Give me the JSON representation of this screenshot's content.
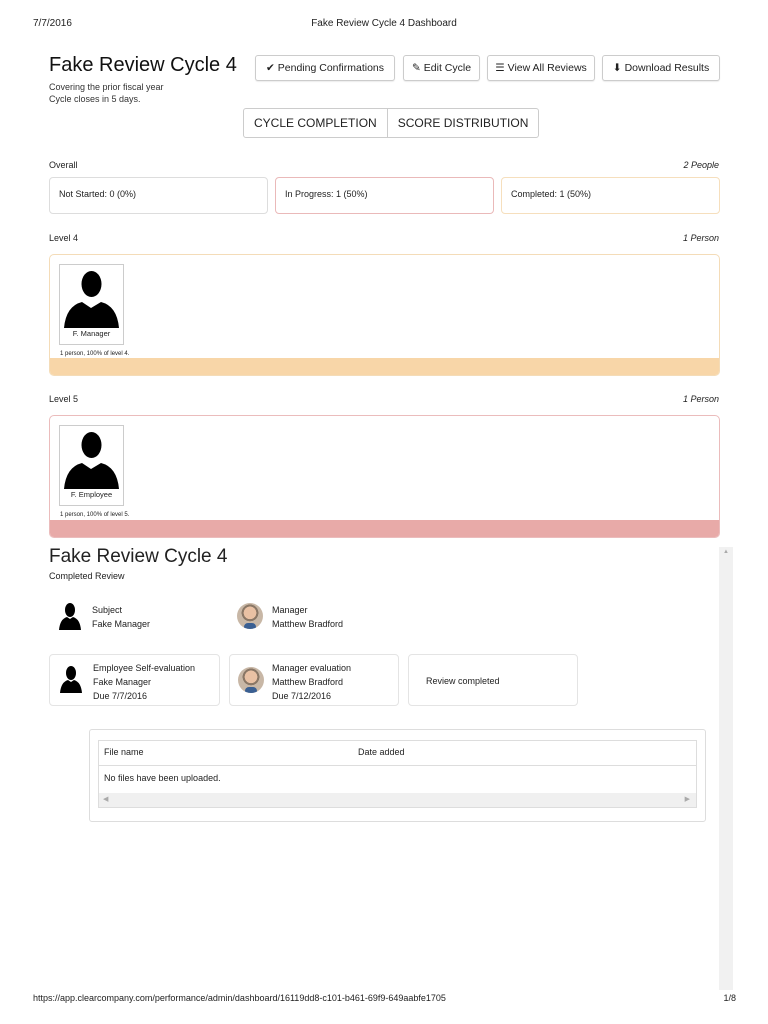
{
  "print_header": {
    "date": "7/7/2016",
    "title": "Fake Review Cycle 4 Dashboard"
  },
  "print_footer": {
    "url": "https://app.clearcompany.com/performance/admin/dashboard/16119dd8-c101-b461-69f9-649aabfe1705",
    "page": "1/8"
  },
  "cycle": {
    "title": "Fake Review Cycle 4",
    "subtitle1": "Covering the prior fiscal year",
    "subtitle2": "Cycle closes in 5 days."
  },
  "toolbar": {
    "pending": "Pending Confirmations",
    "edit": "Edit Cycle",
    "view_all": "View All Reviews",
    "download": "Download Results"
  },
  "tabs": [
    "CYCLE COMPLETION",
    "SCORE DISTRIBUTION"
  ],
  "overall": {
    "label": "Overall",
    "count": "2 People",
    "not_started": "Not Started: 0 (0%)",
    "in_progress": "In Progress: 1 (50%)",
    "completed": "Completed: 1 (50%)"
  },
  "levels": [
    {
      "label": "Level 4",
      "count": "1 Person",
      "person": "F. Manager",
      "note": "1 person, 100% of level 4.",
      "fill": 1.0,
      "color": "#f8d6a8",
      "border": "#f4dcb8"
    },
    {
      "label": "Level 5",
      "count": "1 Person",
      "person": "F. Employee",
      "note": "1 person, 100% of level 5.",
      "fill": 1.0,
      "color": "#e8aaa8",
      "border": "#ebbcbc"
    }
  ],
  "review": {
    "title": "Fake Review Cycle 4",
    "status": "Completed Review",
    "subject_label": "Subject",
    "subject_name": "Fake Manager",
    "manager_label": "Manager",
    "manager_name": "Matthew Bradford",
    "steps": [
      {
        "title": "Employee Self-evaluation",
        "name": "Fake Manager",
        "due": "Due 7/7/2016"
      },
      {
        "title": "Manager evaluation",
        "name": "Matthew Bradford",
        "due": "Due 7/12/2016"
      },
      {
        "title": "Review completed"
      }
    ],
    "files": {
      "col1": "File name",
      "col2": "Date added",
      "empty": "No files have been uploaded."
    }
  }
}
